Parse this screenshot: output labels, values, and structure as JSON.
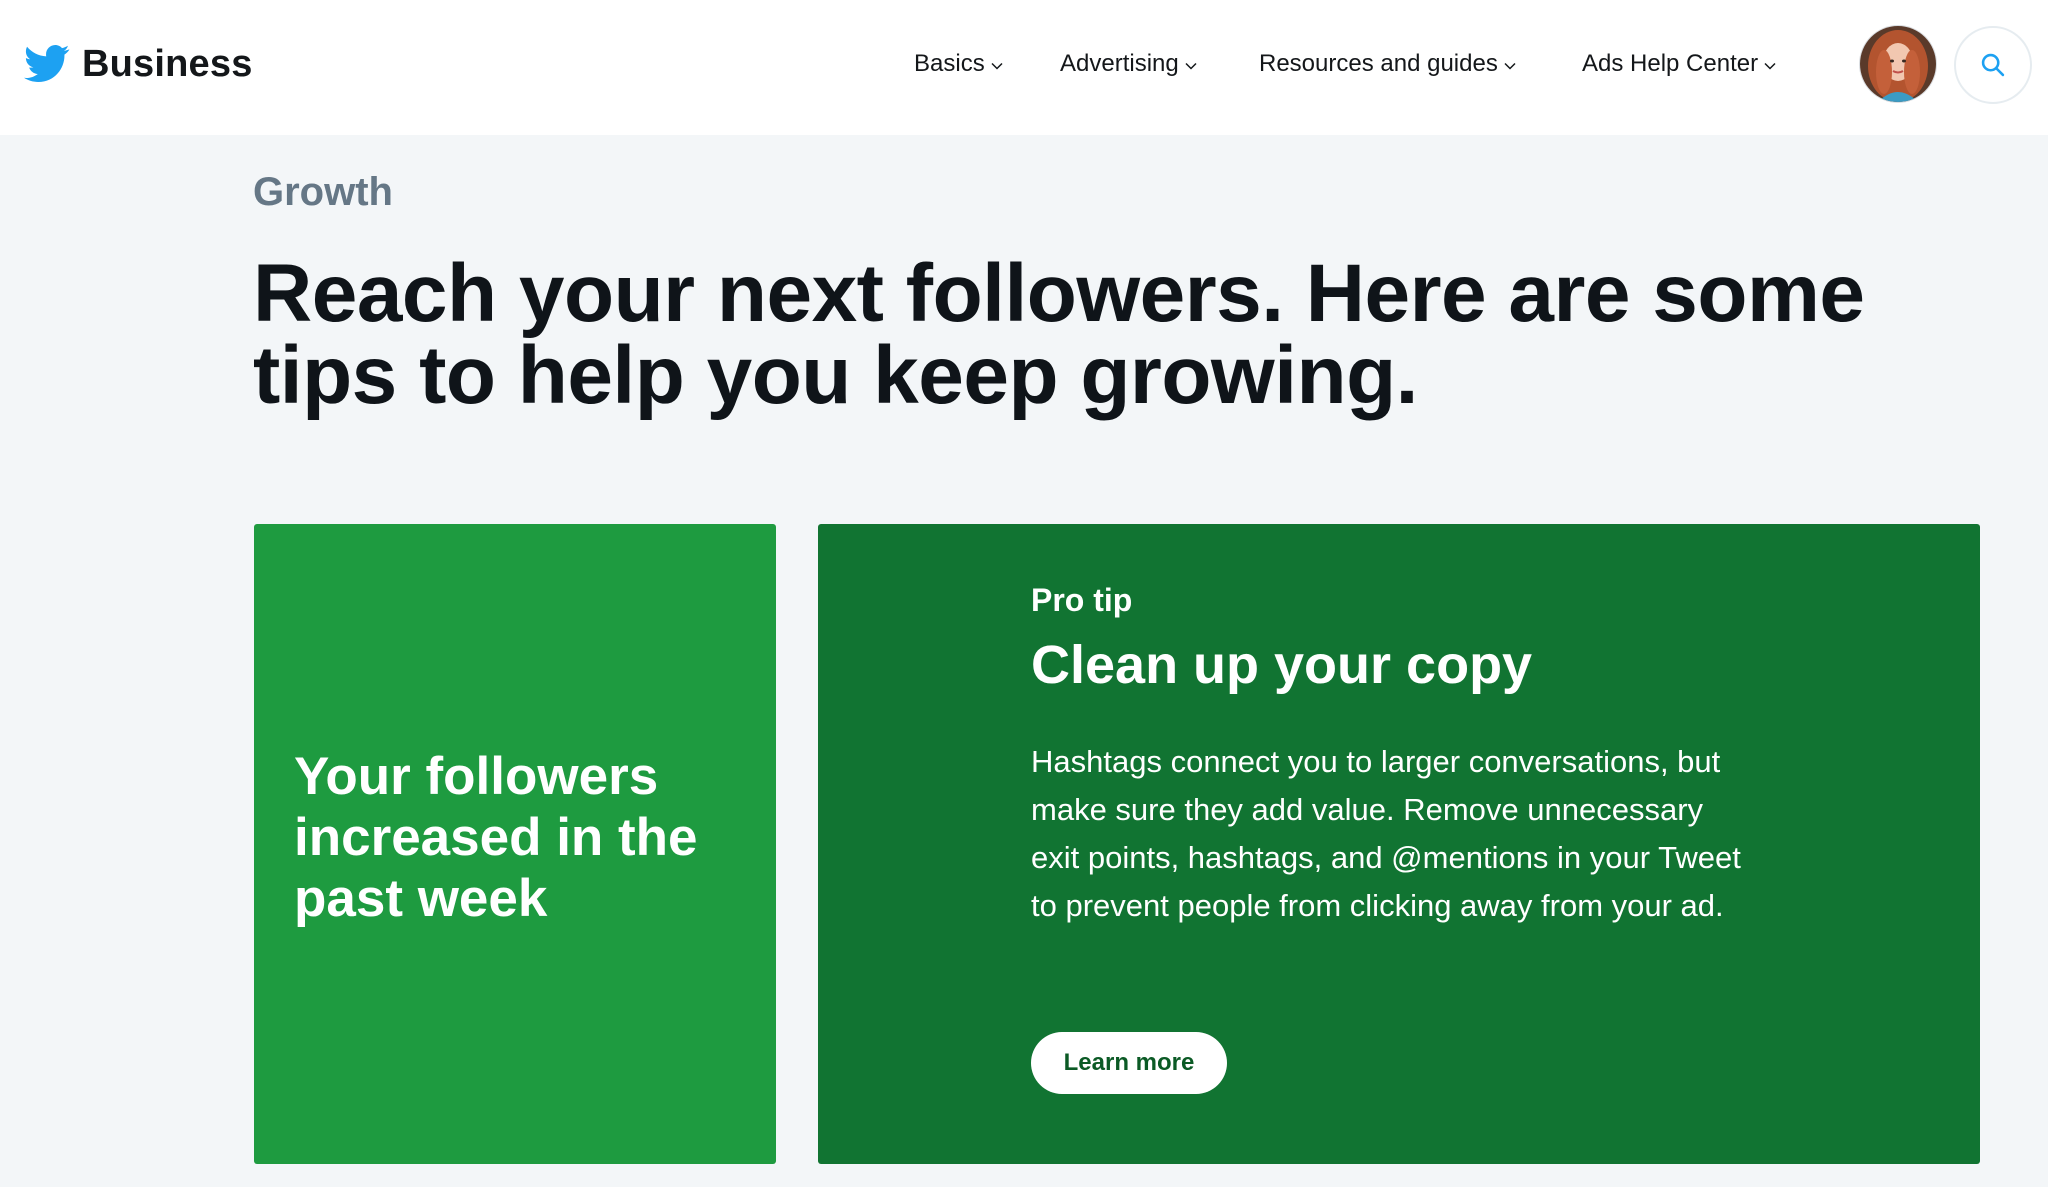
{
  "header": {
    "brand": "Business",
    "nav": [
      {
        "label": "Basics"
      },
      {
        "label": "Advertising"
      },
      {
        "label": "Resources and guides"
      },
      {
        "label": "Ads Help Center"
      }
    ]
  },
  "main": {
    "eyebrow": "Growth",
    "headline": "Reach your next followers. Here are some tips to help you keep growing.",
    "stat_card": {
      "text": "Your followers increased in the past week"
    },
    "tip_card": {
      "label": "Pro tip",
      "title": "Clean up your copy",
      "body": "Hashtags connect you to larger conversations, but make sure they add value. Remove unnecessary exit points, hashtags, and @mentions in your Tweet to prevent people from clicking away from your ad.",
      "button": "Learn more"
    }
  },
  "colors": {
    "twitter_blue": "#1da1f2",
    "stat_card_green": "#1e9b40",
    "tip_card_green": "#117432",
    "page_background": "#f3f6f8"
  },
  "icons": {
    "logo": "twitter-bird-icon",
    "nav_dropdown": "chevron-down-icon",
    "search": "search-icon"
  }
}
